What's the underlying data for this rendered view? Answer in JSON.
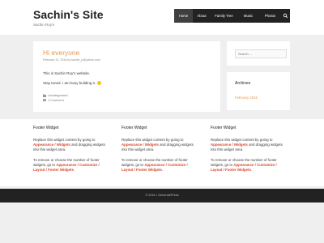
{
  "site": {
    "title": "Sachin's Site",
    "description": "Sachin Roy's"
  },
  "nav": {
    "items": [
      {
        "label": "Home",
        "active": true
      },
      {
        "label": "About"
      },
      {
        "label": "Family Tree"
      },
      {
        "label": "Music"
      },
      {
        "label": "Photos"
      }
    ],
    "search_icon": "search-icon"
  },
  "post": {
    "title": "Hi everyone",
    "meta": "February 12, 2016 by sachin_jr@yahoo.com",
    "paragraph1": "This is Sachin Roy's website.",
    "paragraph2": "Stay tuned. I am busy building it..",
    "category": "Uncategorized",
    "comments": "1 Comment"
  },
  "sidebar": {
    "search_placeholder": "Search ...",
    "archives_title": "Archives",
    "archives_link": "February 2016"
  },
  "footer_widgets": [
    {
      "title": "Footer Widget",
      "t1": "Replace this widget content by going to ",
      "h1": "Appearance / Widgets",
      "t2": " and dragging widgets into this widget area.",
      "t3": "To remove or choose the number of footer widgets, go to ",
      "h2": "Appearance / Customize / Layout / Footer Widgets",
      "t4": "."
    },
    {
      "title": "Footer Widget",
      "t1": "Replace this widget content by going to ",
      "h1": "Appearance / Widgets",
      "t2": " and dragging widgets into this widget area.",
      "t3": "To remove or choose the number of footer widgets, go to ",
      "h2": "Appearance / Customize / Layout / Footer Widgets",
      "t4": "."
    },
    {
      "title": "Footer Widget",
      "t1": "Replace this widget content by going to ",
      "h1": "Appearance / Widgets",
      "t2": " and dragging widgets into this widget area.",
      "t3": "To remove or choose the number of footer widgets, go to ",
      "h2": "Appearance / Customize / Layout / Footer Widgets",
      "t4": "."
    }
  ],
  "copyright": "© 2016 • GeneratePress",
  "colors": {
    "accent": "#e29a52",
    "widget_link": "#d9472b",
    "nav_bg": "#222222"
  }
}
